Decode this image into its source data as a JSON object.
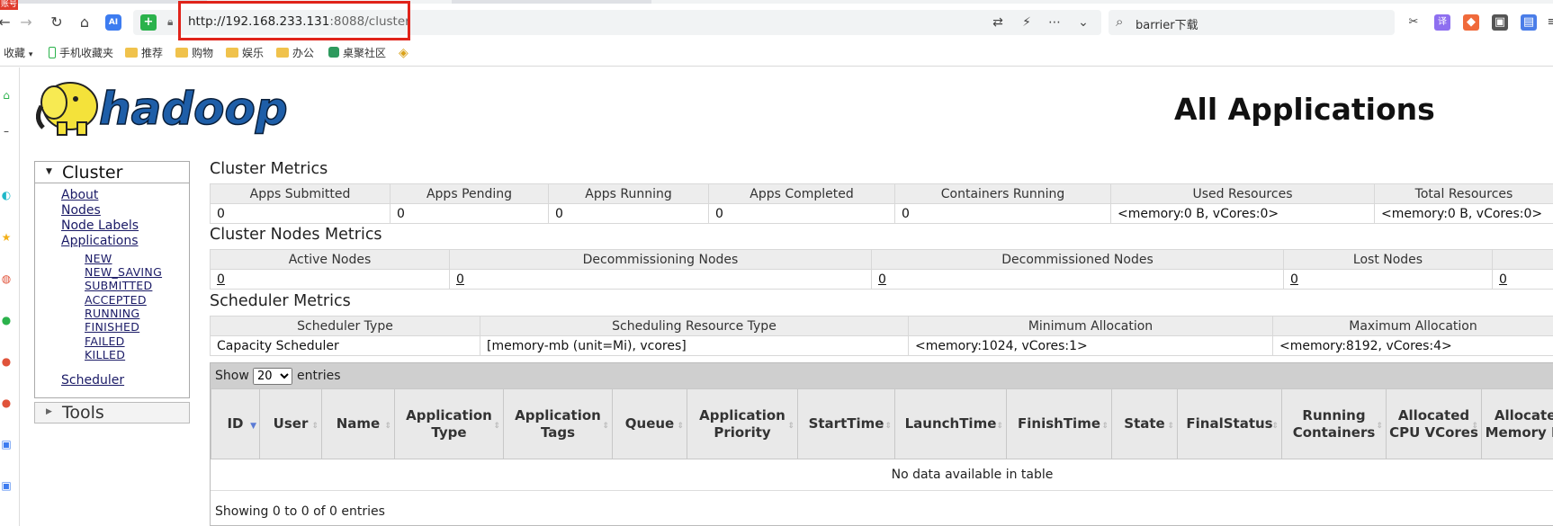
{
  "browser": {
    "corner_badge": "账号",
    "url_host": "http://192.168.233.131",
    "url_rest": ":8088/cluster",
    "search_text": "barrier下载",
    "ai_label": "AI"
  },
  "bookmarks": [
    {
      "label": "收藏",
      "kind": "menu"
    },
    {
      "label": "手机收藏夹",
      "kind": "phone"
    },
    {
      "label": "推荐",
      "kind": "folder"
    },
    {
      "label": "购物",
      "kind": "folder"
    },
    {
      "label": "娱乐",
      "kind": "folder"
    },
    {
      "label": "办公",
      "kind": "folder"
    },
    {
      "label": "桌聚社区",
      "kind": "site"
    }
  ],
  "page": {
    "logo_text": "hadoop",
    "title": "All Applications"
  },
  "nav": {
    "cluster_label": "Cluster",
    "links": [
      "About",
      "Nodes",
      "Node Labels",
      "Applications"
    ],
    "app_states": [
      "NEW",
      "NEW_SAVING",
      "SUBMITTED",
      "ACCEPTED",
      "RUNNING",
      "FINISHED",
      "FAILED",
      "KILLED"
    ],
    "scheduler": "Scheduler",
    "tools_label": "Tools"
  },
  "cluster_metrics": {
    "title": "Cluster Metrics",
    "headers": [
      "Apps Submitted",
      "Apps Pending",
      "Apps Running",
      "Apps Completed",
      "Containers Running",
      "Used Resources",
      "Total Resources"
    ],
    "values": [
      "0",
      "0",
      "0",
      "0",
      "0",
      "<memory:0 B, vCores:0>",
      "<memory:0 B, vCores:0>"
    ]
  },
  "nodes_metrics": {
    "title": "Cluster Nodes Metrics",
    "headers": [
      "Active Nodes",
      "Decommissioning Nodes",
      "Decommissioned Nodes",
      "Lost Nodes",
      ""
    ],
    "values": [
      "0",
      "0",
      "0",
      "0",
      "0"
    ]
  },
  "scheduler_metrics": {
    "title": "Scheduler Metrics",
    "headers": [
      "Scheduler Type",
      "Scheduling Resource Type",
      "Minimum Allocation",
      "Maximum Allocation"
    ],
    "values": [
      "Capacity Scheduler",
      "[memory-mb (unit=Mi), vcores]",
      "<memory:1024, vCores:1>",
      "<memory:8192, vCores:4>"
    ]
  },
  "apps_table": {
    "show_label": "Show",
    "page_size": "20",
    "entries_label": "entries",
    "columns": [
      "ID",
      "User",
      "Name",
      "Application Type",
      "Application Tags",
      "Queue",
      "Application Priority",
      "StartTime",
      "LaunchTime",
      "FinishTime",
      "State",
      "FinalStatus",
      "Running Containers",
      "Allocated CPU VCores",
      "Allocated Memory MB"
    ],
    "empty_message": "No data available in table",
    "info": "Showing 0 to 0 of 0 entries"
  }
}
